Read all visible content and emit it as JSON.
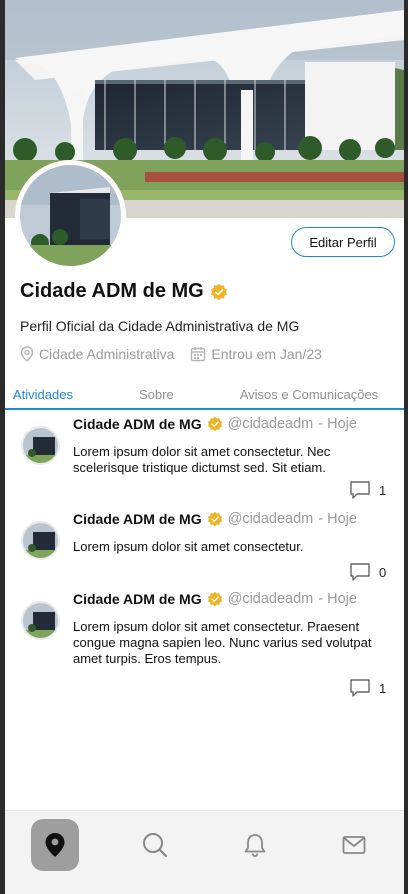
{
  "profile": {
    "name": "Cidade ADM de MG",
    "edit_label": "Editar Perfil",
    "bio": "Perfil Oficial da Cidade Administrativa de MG",
    "location": "Cidade Administrativa",
    "joined": "Entrou em Jan/23"
  },
  "tabs": [
    {
      "label": "Atividades",
      "active": true
    },
    {
      "label": "Sobre",
      "active": false
    },
    {
      "label": "Avisos e Comunicações",
      "active": false
    }
  ],
  "posts": [
    {
      "name": "Cidade ADM de MG",
      "handle": "@cidadeadm",
      "time": "- Hoje",
      "text": "Lorem ipsum dolor sit amet consectetur. Nec scelerisque tristique dictumst sed. Sit etiam.",
      "replies": "1"
    },
    {
      "name": "Cidade ADM de MG",
      "handle": "@cidadeadm",
      "time": "- Hoje",
      "text": "Lorem ipsum dolor sit amet consectetur.",
      "replies": "0"
    },
    {
      "name": "Cidade ADM de MG",
      "handle": "@cidadeadm",
      "time": "- Hoje",
      "text": "Lorem ipsum dolor sit amet consectetur. Praesent congue magna sapien leo. Nunc varius sed volutpat amet turpis. Eros tempus.",
      "replies": "1"
    }
  ],
  "nav": [
    {
      "icon": "map-pin-icon",
      "active": true
    },
    {
      "icon": "search-icon",
      "active": false
    },
    {
      "icon": "bell-icon",
      "active": false
    },
    {
      "icon": "mail-icon",
      "active": false
    }
  ],
  "colors": {
    "accent": "#1d8bd1",
    "verified": "#f0b323",
    "muted": "#9a9a9a"
  }
}
